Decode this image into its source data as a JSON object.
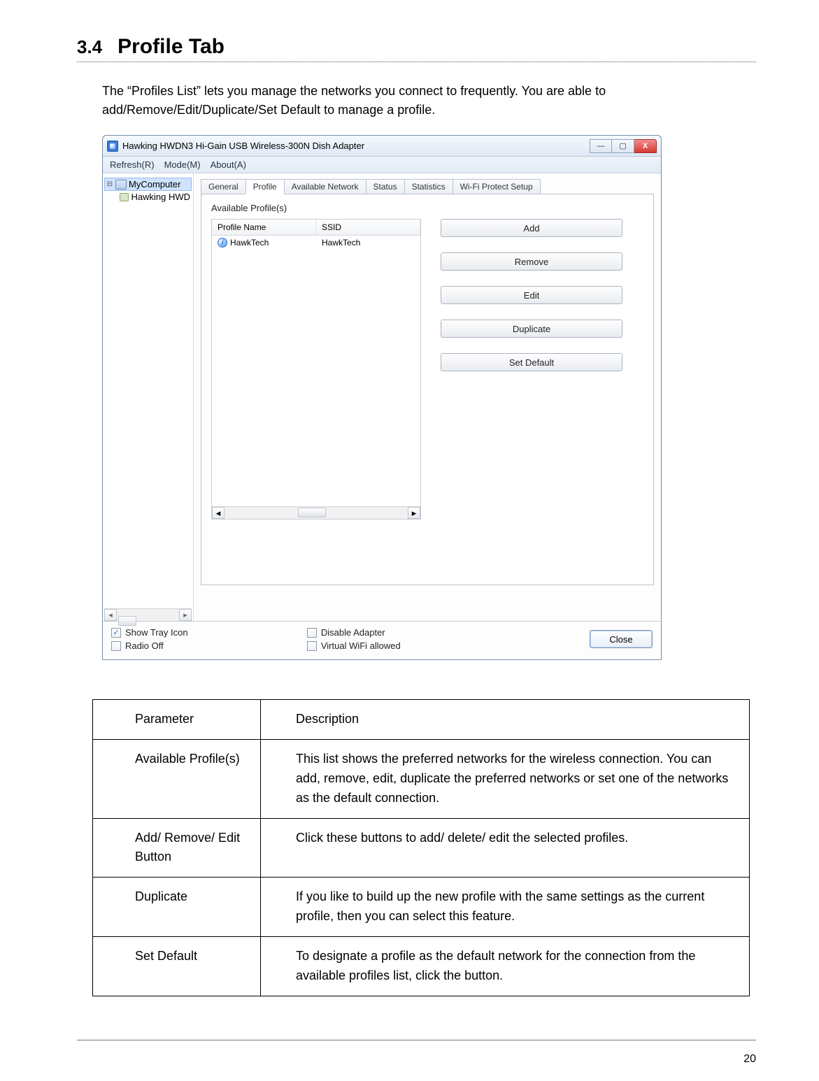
{
  "section": {
    "number": "3.4",
    "title": "Profile Tab"
  },
  "intro": "The “Profiles List” lets you manage the networks you connect to frequently. You are able to add/Remove/Edit/Duplicate/Set Default to manage a profile.",
  "window": {
    "title": "Hawking HWDN3 Hi-Gain USB Wireless-300N Dish Adapter",
    "menu": {
      "refresh": "Refresh(R)",
      "mode": "Mode(M)",
      "about": "About(A)"
    },
    "controls": {
      "min": "—",
      "max": "▢",
      "close": "X"
    },
    "tree": {
      "root": "MyComputer",
      "child": "Hawking HWD"
    },
    "tabs": {
      "general": "General",
      "profile": "Profile",
      "available": "Available Network",
      "status": "Status",
      "statistics": "Statistics",
      "wps": "Wi-Fi Protect Setup"
    },
    "profiles_label": "Available Profile(s)",
    "columns": {
      "name": "Profile Name",
      "ssid": "SSID"
    },
    "rows": [
      {
        "name": "HawkTech",
        "ssid": "HawkTech"
      }
    ],
    "buttons": {
      "add": "Add",
      "remove": "Remove",
      "edit": "Edit",
      "duplicate": "Duplicate",
      "setdefault": "Set Default"
    },
    "footer": {
      "show_tray": "Show Tray Icon",
      "radio_off": "Radio Off",
      "disable_adapter": "Disable Adapter",
      "vwifi": "Virtual WiFi allowed",
      "close": "Close"
    }
  },
  "table": {
    "header": {
      "param": "Parameter",
      "desc": "Description"
    },
    "rows": [
      {
        "param": "Available Profile(s)",
        "desc": "This list shows the preferred networks for the wireless connection. You can add, remove, edit, duplicate the preferred networks or set one of the networks as the default connection."
      },
      {
        "param": "Add/ Remove/ Edit Button",
        "desc": "Click these buttons to add/ delete/ edit the selected profiles."
      },
      {
        "param": "Duplicate",
        "desc": "If you like to build up the new profile with the same settings as the current profile, then you can select this feature."
      },
      {
        "param": "Set Default",
        "desc": "To designate a profile as the default network for the connection from the available profiles list, click the button."
      }
    ]
  },
  "page_number": "20"
}
